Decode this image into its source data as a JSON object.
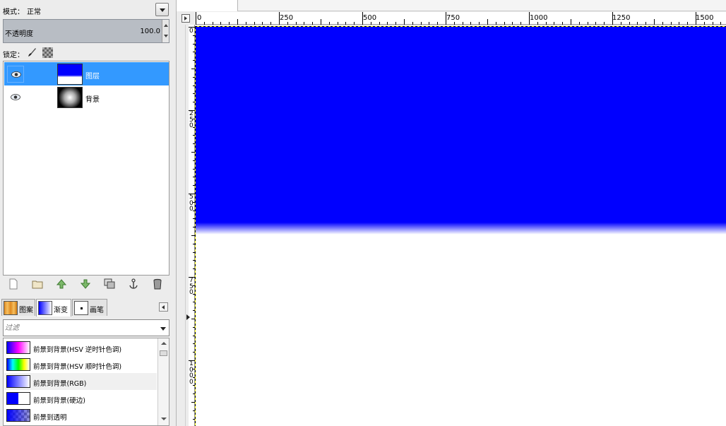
{
  "layers_dock": {
    "mode_label": "模式：",
    "mode_value": "正常",
    "opacity_label": "不透明度",
    "opacity_value": "100.0",
    "lock_label": "锁定：",
    "layers": [
      {
        "name": "图层",
        "selected": true,
        "thumb": "blue-white-gradient"
      },
      {
        "name": "背景",
        "selected": false,
        "thumb": "radial-white-black"
      }
    ],
    "toolbar_icons": [
      "new-layer-icon",
      "new-layer-group-icon",
      "raise-layer-icon",
      "lower-layer-icon",
      "duplicate-layer-icon",
      "anchor-layer-icon",
      "delete-layer-icon"
    ]
  },
  "resource_tabs": [
    {
      "label": "图案",
      "active": false
    },
    {
      "label": "渐变",
      "active": true
    },
    {
      "label": "画笔",
      "active": false
    }
  ],
  "filter": {
    "placeholder": "过滤"
  },
  "gradients": [
    {
      "label": "前景到背景(HSV 逆时针色调)",
      "hover": false
    },
    {
      "label": "前景到背景(HSV 顺时针色调)",
      "hover": false
    },
    {
      "label": "前景到背景(RGB)",
      "hover": true
    },
    {
      "label": "前景到背景(硬边)",
      "hover": false
    },
    {
      "label": "前景到透明",
      "hover": false
    }
  ],
  "rulers": {
    "horizontal": [
      "0",
      "250",
      "500",
      "750",
      "1000",
      "1250",
      "1500"
    ],
    "vertical": [
      "0",
      "250",
      "500",
      "750",
      "1000"
    ]
  },
  "colors": {
    "foreground": "#0000ff",
    "background": "#ffffff",
    "selection": "#3399ff"
  }
}
